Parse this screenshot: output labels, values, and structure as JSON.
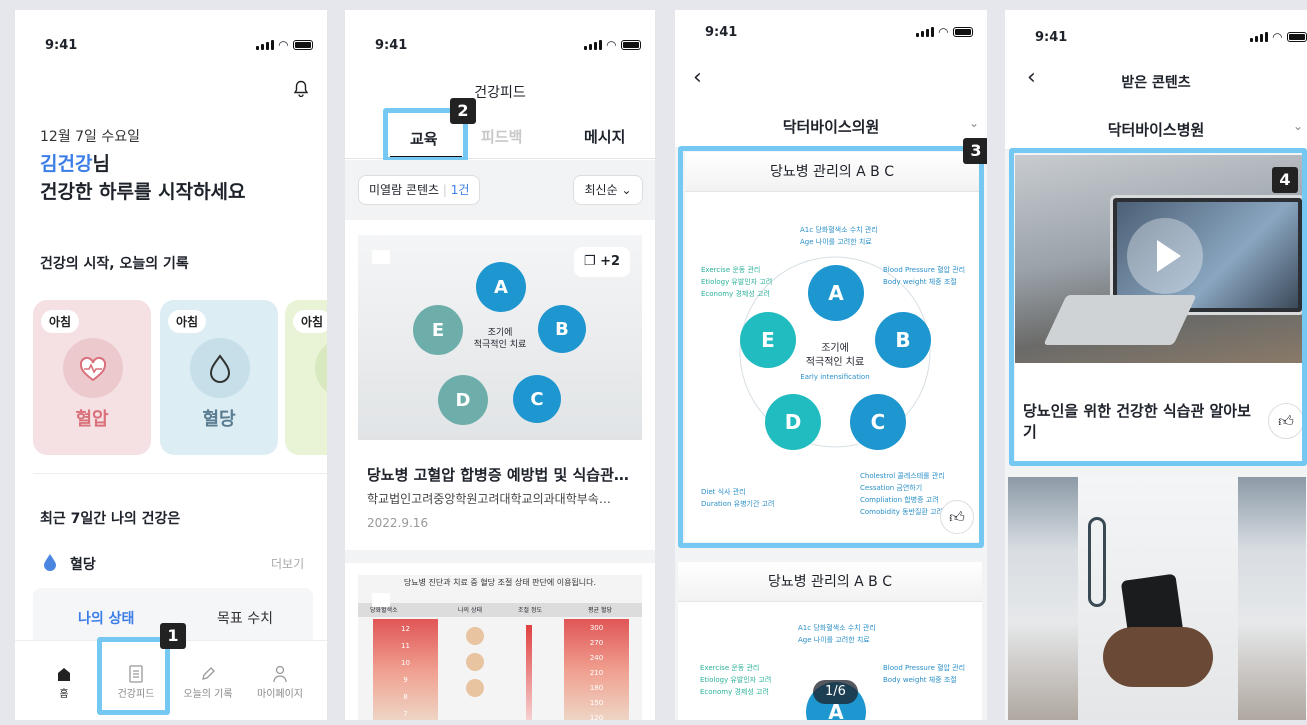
{
  "status_time": "9:41",
  "screen1": {
    "date": "12월 7일 수요일",
    "user_name": "김건강",
    "name_suffix": "님",
    "greeting": "건강한 하루를 시작하세요",
    "record_title": "건강의 시작, 오늘의 기록",
    "cards": [
      {
        "badge": "아침",
        "label": "혈압",
        "bg": "#f5e1e3",
        "color": "#d9707a"
      },
      {
        "badge": "아침",
        "label": "혈당",
        "bg": "#dcedf3",
        "color": "#5a7c90"
      },
      {
        "badge": "아침",
        "label": "",
        "bg": "#e9f3d6",
        "color": "#7a9a50"
      }
    ],
    "weekly_title": "최근 7일간 나의 건강은",
    "metric_label": "혈당",
    "more": "더보기",
    "seg_tabs": [
      "나의 상태",
      "목표 수치"
    ],
    "tabbar": [
      "홈",
      "건강피드",
      "오늘의 기록",
      "마이페이지"
    ],
    "marker": "1"
  },
  "screen2": {
    "title": "건강피드",
    "tabs": [
      "교육",
      "피드백",
      "메시지"
    ],
    "filter_label": "미열람 콘텐츠",
    "filter_count": "1건",
    "sort": "최신순",
    "badge_more": "+2",
    "post_title": "당뇨병 고혈압 합병증 예방법 및 식습관…",
    "post_sub": "학교법인고려중앙학원고려대학교의과대학부속…",
    "post_date": "2022.9.16",
    "table_header": "당뇨병 진단과 치료 중 혈당 조절 상태 판단에 이용됩니다.",
    "table_cols": [
      "당화혈색소",
      "나의 상태",
      "조절 정도",
      "평균 혈당"
    ],
    "table_left": [
      "12",
      "11",
      "10",
      "9",
      "8",
      "7"
    ],
    "table_right": [
      "300",
      "270",
      "240",
      "210",
      "180",
      "150",
      "120"
    ],
    "marker": "2"
  },
  "screen3": {
    "hospital": "닥터바이스의원",
    "card_title": "당뇨병 관리의 A B C",
    "center_line1": "조기에",
    "center_line2": "적극적인 치료",
    "center_en": "Early intensification",
    "bubbles": [
      "A",
      "B",
      "C",
      "D",
      "E"
    ],
    "notes": {
      "a": [
        "A1c 당화혈색소 수치 관리",
        "Age 나이를 고려한 치료"
      ],
      "b": [
        "Blood Pressure 혈압 관리",
        "Body weight 체중 조절"
      ],
      "c": [
        "Cholestrol 콜레스테롤 관리",
        "Cessation 금연하기",
        "Compliation 합병증 고려",
        "Comobidity 동반질환 고려"
      ],
      "d": [
        "Diet 식사 관리",
        "Duration 유병기간 고려"
      ],
      "e": [
        "Exercise 운동 관리",
        "Etiology 유발인자 고려",
        "Economy 경제성 고려"
      ]
    },
    "pager": "1/6",
    "marker": "3"
  },
  "screen4": {
    "title": "받은 콘텐츠",
    "hospital": "닥터바이스병원",
    "post_title": "당뇨인을 위한 건강한 식습관 알아보기",
    "marker": "4"
  },
  "colors": {
    "highlight": "#74c8f2",
    "accent_blue": "#3b7ee8",
    "bubble_blue": "#1e96cf",
    "bubble_teal": "#21bcc0"
  }
}
